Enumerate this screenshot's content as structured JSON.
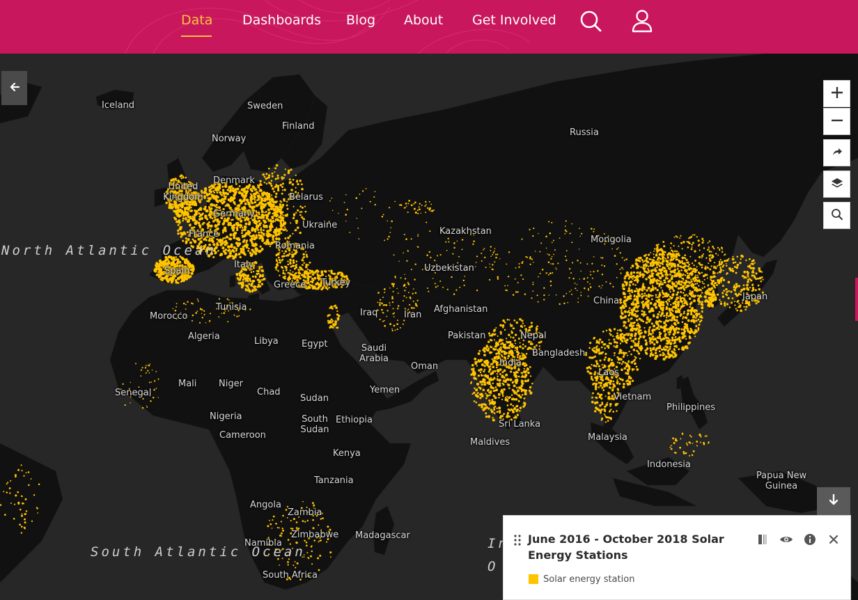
{
  "nav": {
    "items": [
      {
        "label": "Data",
        "active": true
      },
      {
        "label": "Dashboards",
        "active": false
      },
      {
        "label": "Blog",
        "active": false
      },
      {
        "label": "About",
        "active": false
      },
      {
        "label": "Get Involved",
        "active": false
      }
    ],
    "icons": [
      "search-icon",
      "user-icon"
    ],
    "background_color": "#c8175c",
    "active_color": "#f8c33a"
  },
  "map": {
    "countries": [
      "Iceland",
      "Sweden",
      "Finland",
      "Russia",
      "Norway",
      "Denmark",
      "United Kingdom",
      "Belarus",
      "Germany",
      "Ukraine",
      "France",
      "Romania",
      "Kazakhstan",
      "Mongolia",
      "Spain",
      "Italy",
      "Uzbekistan",
      "Turkey",
      "Greece",
      "Tunisia",
      "China",
      "Japan",
      "Iraq",
      "Iran",
      "Afghanistan",
      "Morocco",
      "Algeria",
      "Libya",
      "Egypt",
      "Pakistan",
      "Nepal",
      "Saudi Arabia",
      "Bangladesh",
      "India",
      "Oman",
      "Laos",
      "Mali",
      "Niger",
      "Chad",
      "Yemen",
      "Senegal",
      "Sudan",
      "Vietnam",
      "Philippines",
      "Nigeria",
      "South Sudan",
      "Ethiopia",
      "Sri Lanka",
      "Cameroon",
      "Malaysia",
      "Maldives",
      "Kenya",
      "Indonesia",
      "Tanzania",
      "Papua New Guinea",
      "Angola",
      "Zambia",
      "Zimbabwe",
      "Madagascar",
      "Namibia",
      "South Africa"
    ],
    "oceans": [
      "North Atlantic Ocean",
      "South Atlantic Ocean",
      "Indian Ocean"
    ],
    "ocean_fragments": {
      "indian_1": "In",
      "indian_2": "O"
    },
    "point_color": "#ffc400",
    "land_color": "#111111",
    "water_color": "#272727"
  },
  "controls": {
    "back": "arrow-left-icon",
    "zoom_in": "plus-icon",
    "zoom_out": "minus-icon",
    "share": "share-icon",
    "layers": "layers-icon",
    "search": "search-icon",
    "collapse": "arrow-down-icon"
  },
  "legend": {
    "title": "June 2016 - October 2018 Solar Energy Stations",
    "items": [
      {
        "label": "Solar energy station",
        "color": "#ffc400"
      }
    ],
    "tools": [
      "opacity-icon",
      "eye-icon",
      "info-icon",
      "close-icon"
    ]
  }
}
